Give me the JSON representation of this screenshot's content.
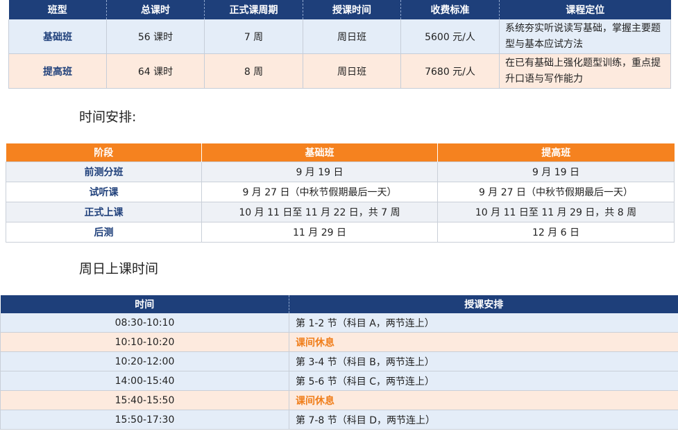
{
  "course_table": {
    "headers": [
      "班型",
      "总课时",
      "正式课周期",
      "授课时间",
      "收费标准",
      "课程定位"
    ],
    "rows": [
      {
        "name": "基础班",
        "hours": "56 课时",
        "period": "7 周",
        "time": "周日班",
        "fee": "5600 元/人",
        "desc": "系统夯实听说读写基础，掌握主要题型与基本应试方法"
      },
      {
        "name": "提高班",
        "hours": "64 课时",
        "period": "8 周",
        "time": "周日班",
        "fee": "7680 元/人",
        "desc": "在已有基础上强化题型训练，重点提升口语与写作能力"
      }
    ]
  },
  "schedule_heading": "时间安排:",
  "schedule_table": {
    "headers": [
      "阶段",
      "基础班",
      "提高班"
    ],
    "rows": [
      {
        "stage": "前测分班",
        "basic": "9 月 19 日",
        "advanced": "9 月 19 日"
      },
      {
        "stage": "试听课",
        "basic": "9 月 27 日（中秋节假期最后一天）",
        "advanced": "9 月 27 日（中秋节假期最后一天）"
      },
      {
        "stage": "正式上课",
        "basic": "10 月 11 日至 11 月 22 日，共 7 周",
        "advanced": "10 月 11 日至 11 月 29 日，共 8 周"
      },
      {
        "stage": "后测",
        "basic": "11 月 29 日",
        "advanced": "12 月 6 日"
      }
    ]
  },
  "sunday_heading": "周日上课时间",
  "sunday_table": {
    "headers": [
      "时间",
      "授课安排"
    ],
    "rows": [
      {
        "time": "08:30-10:10",
        "activity": "第 1-2 节（科目 A，两节连上）"
      },
      {
        "time": "10:10-10:20",
        "activity": "课间休息"
      },
      {
        "time": "10:20-12:00",
        "activity": "第 3-4 节（科目 B，两节连上）"
      },
      {
        "time": "14:00-15:40",
        "activity": "第 5-6 节（科目 C，两节连上）"
      },
      {
        "time": "15:40-15:50",
        "activity": "课间休息"
      },
      {
        "time": "15:50-17:30",
        "activity": "第 7-8 节（科目 D，两节连上）"
      }
    ]
  },
  "colors": {
    "navy": "#1e3f7a",
    "orange": "#f5821f",
    "light_blue": "#e4edf8",
    "light_peach": "#fdeade"
  }
}
